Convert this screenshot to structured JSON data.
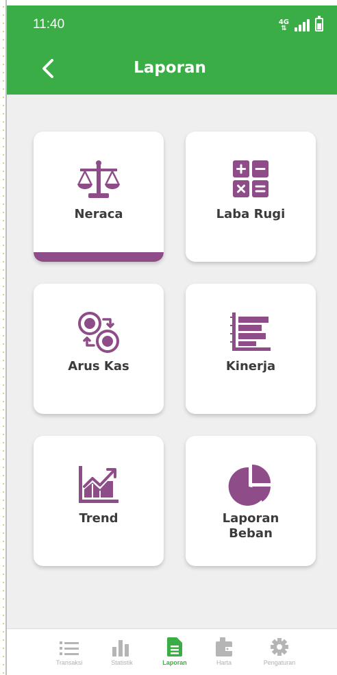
{
  "status_bar": {
    "time": "11:40",
    "network": "4G"
  },
  "header": {
    "title": "Laporan"
  },
  "menu": [
    {
      "label": "Neraca",
      "icon": "balance-scale-icon",
      "selected": true
    },
    {
      "label": "Laba Rugi",
      "icon": "calculator-icon",
      "selected": false
    },
    {
      "label": "Arus Kas",
      "icon": "cash-flow-icon",
      "selected": false
    },
    {
      "label": "Kinerja",
      "icon": "bar-list-icon",
      "selected": false
    },
    {
      "label": "Trend",
      "icon": "trend-chart-icon",
      "selected": false
    },
    {
      "label": "Laporan Beban",
      "icon": "pie-chart-icon",
      "selected": false
    }
  ],
  "bottom_nav": [
    {
      "label": "Transaksi",
      "icon": "list-icon",
      "active": false
    },
    {
      "label": "Statistik",
      "icon": "bar-chart-icon",
      "active": false
    },
    {
      "label": "Laporan",
      "icon": "document-icon",
      "active": true
    },
    {
      "label": "Harta",
      "icon": "wallet-icon",
      "active": false
    },
    {
      "label": "Pengaturan",
      "icon": "gear-icon",
      "active": false
    }
  ],
  "colors": {
    "header": "#3aad46",
    "accent": "#8e4c88",
    "background": "#efefef",
    "inactive_nav": "#b0b0b0"
  }
}
